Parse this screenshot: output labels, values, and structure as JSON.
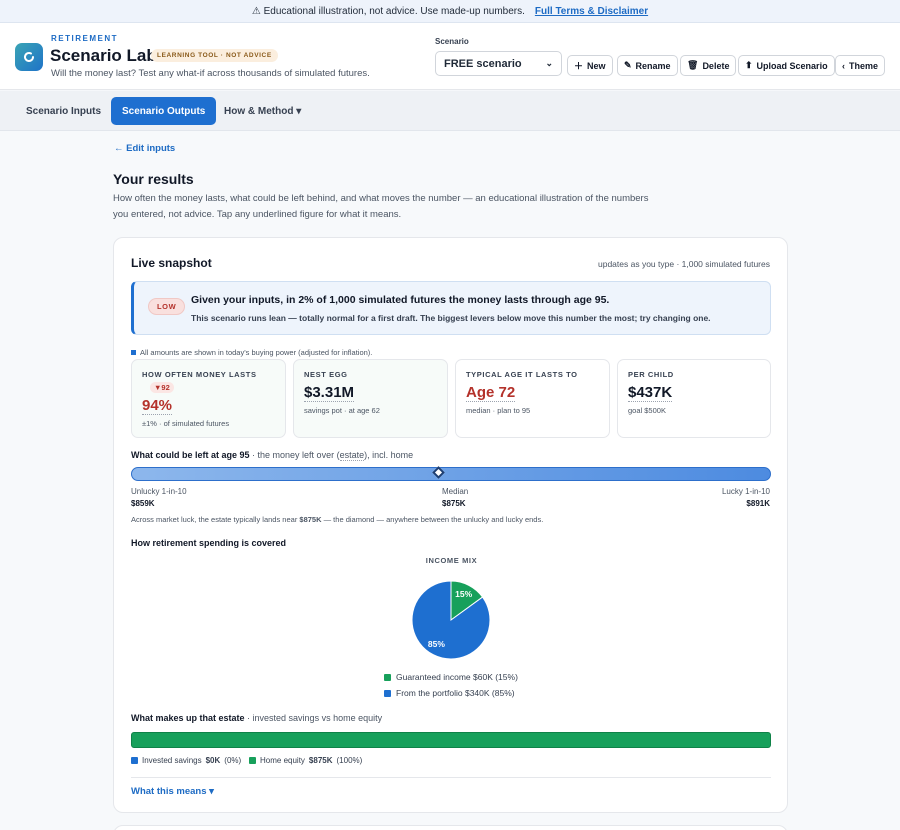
{
  "banner": {
    "text": "⚠ Educational illustration, not advice. Use made-up numbers.",
    "link": "Full Terms & Disclaimer"
  },
  "brand": {
    "kicker": "RETIREMENT",
    "title": "Scenario Lab.",
    "badge": "LEARNING TOOL · NOT ADVICE",
    "subtitle": "Will the money last? Test any what-if across thousands of simulated futures."
  },
  "scenario": {
    "label": "Scenario",
    "selected": "FREE scenario"
  },
  "toolbar": {
    "new": "New",
    "rename": "Rename",
    "delete": "Delete",
    "upload": "Upload Scenario",
    "theme": "Theme"
  },
  "tabs": {
    "inputs": "Scenario Inputs",
    "outputs": "Scenario Outputs",
    "method": "How & Method ▾"
  },
  "results": {
    "edit": "← Edit inputs",
    "title": "Your results",
    "desc": "How often the money lasts, what could be left behind, and what moves the number — an educational illustration of the numbers you entered, not advice. Tap any underlined figure for what it means."
  },
  "snapshot": {
    "title": "Live snapshot",
    "note": "updates as you type · 1,000 simulated futures",
    "badge": "LOW",
    "headline": "Given your inputs, in 2% of 1,000 simulated futures the money lasts through age 95.",
    "sub": "This scenario runs lean — totally normal for a first draft. The biggest levers below move this number the most; try changing one.",
    "inflation_note": "All amounts are shown in today's buying power (adjusted for inflation)."
  },
  "stats": [
    {
      "label": "HOW OFTEN MONEY LASTS",
      "delta": "▼92",
      "value": "94%",
      "sub": "±1% · of simulated futures"
    },
    {
      "label": "NEST EGG",
      "value": "$3.31M",
      "sub": "savings pot · at age 62"
    },
    {
      "label": "TYPICAL AGE IT LASTS TO",
      "value": "Age 72",
      "sub": "median · plan to 95"
    },
    {
      "label": "PER CHILD",
      "value": "$437K",
      "sub": "goal $500K"
    }
  ],
  "estate_range": {
    "title": "What could be left at age 95",
    "title_muted_a": " · the money left over (",
    "title_link": "estate",
    "title_muted_b": "), incl. home",
    "unlucky_label": "Unlucky 1-in-10",
    "unlucky_value": "$859K",
    "median_label": "Median",
    "median_value": "$875K",
    "lucky_label": "Lucky 1-in-10",
    "lucky_value": "$891K",
    "note_a": "Across market luck, the estate typically lands near ",
    "note_b": "$875K",
    "note_c": " — the diamond — anywhere between the unlucky and lucky ends."
  },
  "spending": {
    "title": "How retirement spending is covered",
    "mix_title": "INCOME MIX",
    "slices": [
      {
        "label": "15%",
        "share": 15,
        "color": "#17a05b",
        "legend": "Guaranteed income $60K (15%)"
      },
      {
        "label": "85%",
        "share": 85,
        "color": "#1e6fd0",
        "legend": "From the portfolio $340K (85%)"
      }
    ]
  },
  "estate_makeup": {
    "title": "What makes up that estate",
    "title_muted": " · invested savings vs home equity",
    "savings_label": "Invested savings",
    "savings_value": "$0K",
    "savings_pct": "(0%)",
    "home_label": "Home equity",
    "home_value": "$875K",
    "home_pct": "(100%)",
    "home_share": 100
  },
  "what_means": "What this means ▾",
  "colors": {
    "accent": "#1e6fd0",
    "green": "#17a05b",
    "warn": "#b4322b"
  }
}
